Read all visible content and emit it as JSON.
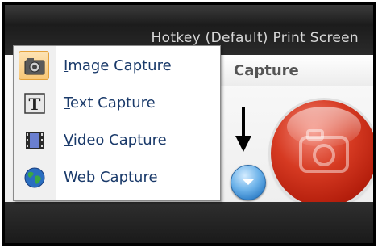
{
  "title_bar": {
    "hotkey_text": "Hotkey (Default) Print Screen"
  },
  "capture_panel": {
    "header_label": "Capture"
  },
  "menu": {
    "items": [
      {
        "accel": "I",
        "rest": "mage Capture",
        "icon": "image-capture-icon",
        "selected": true
      },
      {
        "accel": "T",
        "rest": "ext Capture",
        "icon": "text-capture-icon",
        "selected": false
      },
      {
        "accel": "V",
        "rest": "ideo Capture",
        "icon": "video-capture-icon",
        "selected": false
      },
      {
        "accel": "W",
        "rest": "eb Capture",
        "icon": "web-capture-icon",
        "selected": false
      }
    ]
  },
  "colors": {
    "accent_selected": "#f8c777",
    "capture_button": "#d63a22",
    "dropdown_button": "#4a95d8"
  }
}
